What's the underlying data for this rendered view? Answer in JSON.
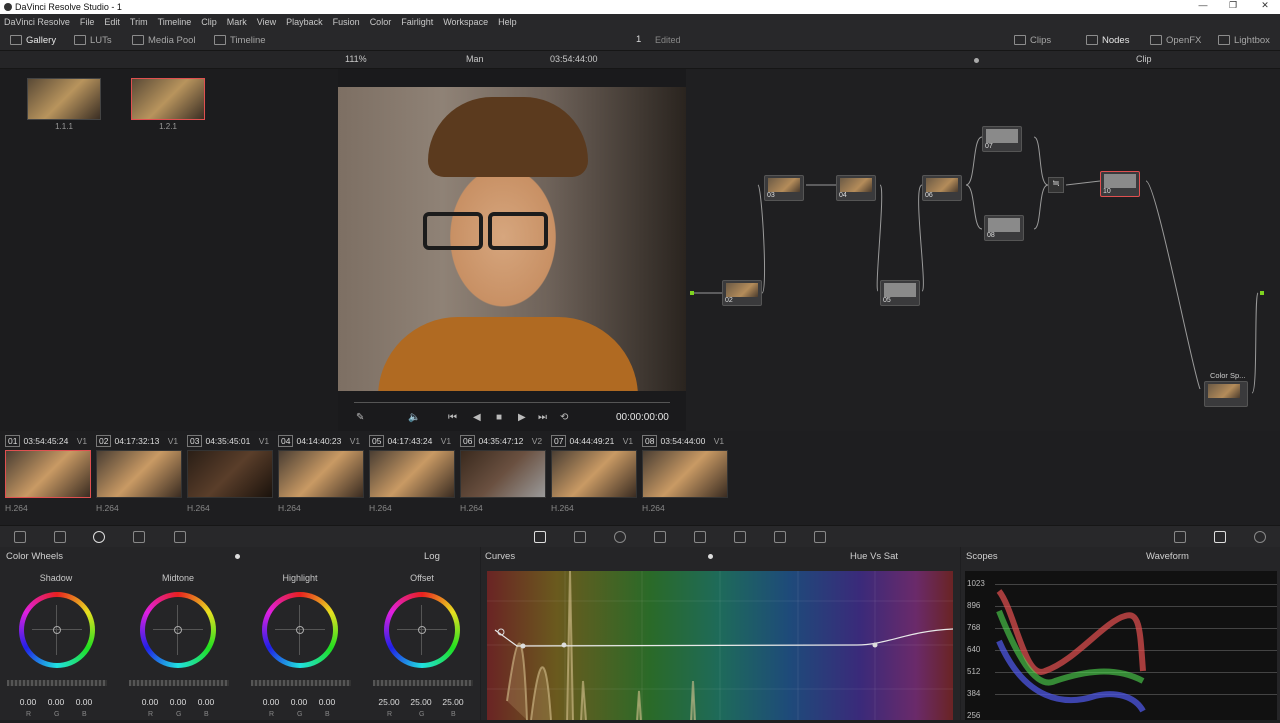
{
  "window": {
    "title": "DaVinci Resolve Studio - 1"
  },
  "menu": [
    "DaVinci Resolve",
    "File",
    "Edit",
    "Trim",
    "Timeline",
    "Clip",
    "Mark",
    "View",
    "Playback",
    "Fusion",
    "Color",
    "Fairlight",
    "Workspace",
    "Help"
  ],
  "toolbar": {
    "gallery": "Gallery",
    "luts": "LUTs",
    "media_pool": "Media Pool",
    "timeline": "Timeline",
    "project_num": "1",
    "edited": "Edited",
    "clips": "Clips",
    "nodes": "Nodes",
    "openfx": "OpenFX",
    "lightbox": "Lightbox"
  },
  "viewer": {
    "zoom": "111%",
    "clip_name": "Man",
    "timecode": "03:54:44:00",
    "playhead": "00:00:00:00",
    "node_mode": "Clip"
  },
  "gallery": {
    "stills": [
      {
        "label": "1.1.1"
      },
      {
        "label": "1.2.1"
      }
    ]
  },
  "nodes": [
    {
      "id": "02"
    },
    {
      "id": "03"
    },
    {
      "id": "04"
    },
    {
      "id": "05"
    },
    {
      "id": "06"
    },
    {
      "id": "07"
    },
    {
      "id": "08"
    },
    {
      "id": "10"
    },
    {
      "id": "Color Sp..."
    }
  ],
  "clips": [
    {
      "num": "01",
      "tc": "03:54:45:24",
      "track": "V1",
      "codec": "H.264"
    },
    {
      "num": "02",
      "tc": "04:17:32:13",
      "track": "V1",
      "codec": "H.264"
    },
    {
      "num": "03",
      "tc": "04:35:45:01",
      "track": "V1",
      "codec": "H.264"
    },
    {
      "num": "04",
      "tc": "04:14:40:23",
      "track": "V1",
      "codec": "H.264"
    },
    {
      "num": "05",
      "tc": "04:17:43:24",
      "track": "V1",
      "codec": "H.264"
    },
    {
      "num": "06",
      "tc": "04:35:47:12",
      "track": "V2",
      "codec": "H.264"
    },
    {
      "num": "07",
      "tc": "04:44:49:21",
      "track": "V1",
      "codec": "H.264"
    },
    {
      "num": "08",
      "tc": "03:54:44:00",
      "track": "V1",
      "codec": "H.264"
    }
  ],
  "color_wheels": {
    "title": "Color Wheels",
    "mode": "Log",
    "wheels": [
      {
        "name": "Shadow",
        "r": "0.00",
        "g": "0.00",
        "b": "0.00"
      },
      {
        "name": "Midtone",
        "r": "0.00",
        "g": "0.00",
        "b": "0.00"
      },
      {
        "name": "Highlight",
        "r": "0.00",
        "g": "0.00",
        "b": "0.00"
      },
      {
        "name": "Offset",
        "r": "25.00",
        "g": "25.00",
        "b": "25.00"
      }
    ],
    "rgb_labels": {
      "r": "R",
      "g": "G",
      "b": "B"
    }
  },
  "curves": {
    "title": "Curves",
    "mode": "Hue Vs Sat"
  },
  "scopes": {
    "title": "Scopes",
    "mode": "Waveform",
    "scale": [
      "1023",
      "896",
      "768",
      "640",
      "512",
      "384",
      "256"
    ]
  },
  "colors": {
    "accent_red": "#e05050",
    "node_green": "#7ed321",
    "node_blue": "#3aa0e0"
  }
}
